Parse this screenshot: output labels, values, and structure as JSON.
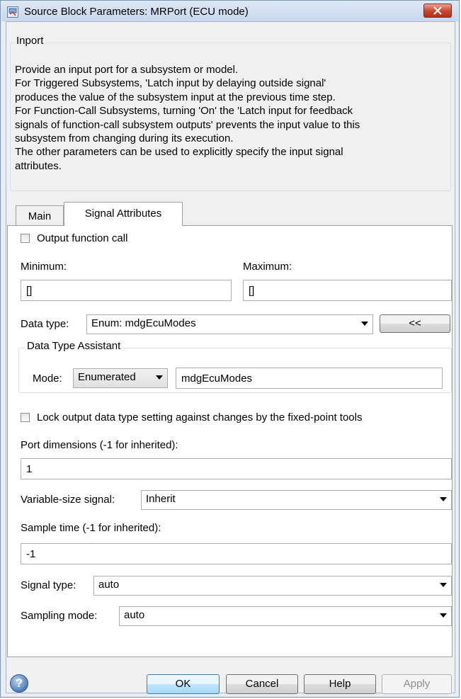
{
  "window": {
    "title": "Source Block Parameters: MRPort (ECU mode)",
    "close_icon": "close-icon"
  },
  "inport": {
    "legend": "Inport",
    "description_lines": [
      "Provide an input port for a subsystem or model.",
      "For Triggered Subsystems, 'Latch input by delaying outside signal'",
      "produces the value of the subsystem input at the previous time step.",
      "For Function-Call Subsystems, turning 'On' the 'Latch input for feedback",
      "signals of function-call subsystem outputs' prevents the input value to this",
      "subsystem from changing during its execution.",
      "The other parameters can be used to explicitly specify the input signal",
      "attributes."
    ]
  },
  "tabs": [
    {
      "label": "Main",
      "active": false
    },
    {
      "label": "Signal Attributes",
      "active": true
    }
  ],
  "signal_attributes": {
    "output_function_call": {
      "label": "Output function call",
      "checked": false
    },
    "minimum": {
      "label": "Minimum:",
      "value": "[]"
    },
    "maximum": {
      "label": "Maximum:",
      "value": "[]"
    },
    "data_type": {
      "label": "Data type:",
      "value": "Enum: mdgEcuModes",
      "toggle_label": "<<"
    },
    "data_type_assistant": {
      "legend": "Data Type Assistant",
      "mode_label": "Mode:",
      "mode_value": "Enumerated",
      "class_value": "mdgEcuModes"
    },
    "lock_output": {
      "label": "Lock output data type setting against changes by the fixed-point tools",
      "checked": false
    },
    "port_dimensions": {
      "label": "Port dimensions (-1 for inherited):",
      "value": "1"
    },
    "variable_size": {
      "label": "Variable-size signal:",
      "value": "Inherit"
    },
    "sample_time": {
      "label": "Sample time (-1 for inherited):",
      "value": "-1"
    },
    "signal_type": {
      "label": "Signal type:",
      "value": "auto"
    },
    "sampling_mode": {
      "label": "Sampling mode:",
      "value": "auto"
    }
  },
  "buttons": {
    "ok": "OK",
    "cancel": "Cancel",
    "help": "Help",
    "apply": "Apply"
  },
  "help_icon": {
    "glyph": "?"
  }
}
